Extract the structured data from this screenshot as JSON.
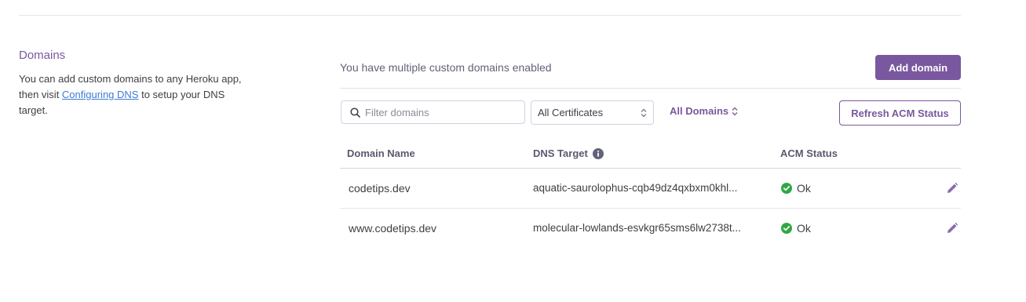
{
  "section": {
    "title": "Domains",
    "desc_before": "You can add custom domains to any Heroku app, then visit ",
    "desc_link": "Configuring DNS",
    "desc_after": " to setup your DNS target."
  },
  "summary": {
    "text": "You have multiple custom domains enabled",
    "add_button": "Add domain"
  },
  "filters": {
    "search_placeholder": "Filter domains",
    "search_value": "",
    "certificates_selected": "All Certificates",
    "domains_selected": "All Domains",
    "refresh_button": "Refresh ACM Status"
  },
  "table": {
    "columns": [
      "Domain Name",
      "DNS Target",
      "ACM Status"
    ],
    "rows": [
      {
        "domain": "codetips.dev",
        "dns_target": "aquatic-saurolophus-cqb49dz4qxbxm0khl...",
        "status": "Ok"
      },
      {
        "domain": "www.codetips.dev",
        "dns_target": "molecular-lowlands-esvkgr65sms6lw2738t...",
        "status": "Ok"
      }
    ]
  },
  "colors": {
    "accent": "#79589f",
    "link": "#3e7bd8",
    "ok": "#2fa844"
  },
  "icons": {
    "search": "search-icon",
    "chevron": "chevron-up-down-icon",
    "info": "info-icon",
    "ok": "check-circle-icon",
    "edit": "pencil-icon"
  }
}
